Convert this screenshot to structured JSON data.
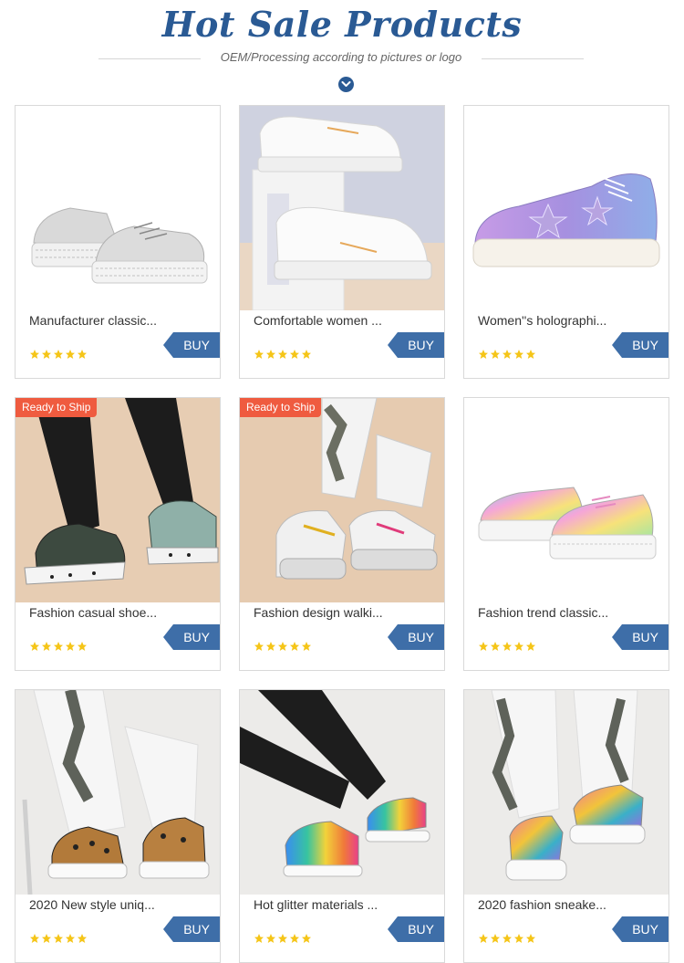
{
  "header": {
    "title": "Hot Sale Products",
    "subtitle": "OEM/Processing according to pictures or logo"
  },
  "colors": {
    "accent": "#2a5a94",
    "buy": "#3e6ea8",
    "badge": "#ef5b3f",
    "star": "#f5c518"
  },
  "products": [
    {
      "name": "Manufacturer classic...",
      "buy_label": "BUY",
      "badge": "",
      "rating": 5
    },
    {
      "name": "Comfortable women ...",
      "buy_label": "BUY",
      "badge": "",
      "rating": 5
    },
    {
      "name": "Women''s holographi...",
      "buy_label": "BUY",
      "badge": "",
      "rating": 5
    },
    {
      "name": "Fashion casual shoe...",
      "buy_label": "BUY",
      "badge": "Ready to Ship",
      "rating": 5
    },
    {
      "name": "Fashion design walki...",
      "buy_label": "BUY",
      "badge": "Ready to Ship",
      "rating": 5
    },
    {
      "name": "Fashion trend classic...",
      "buy_label": "BUY",
      "badge": "",
      "rating": 5
    },
    {
      "name": "2020 New style uniq...",
      "buy_label": "BUY",
      "badge": "",
      "rating": 5
    },
    {
      "name": "Hot glitter materials ...",
      "buy_label": "BUY",
      "badge": "",
      "rating": 5
    },
    {
      "name": "2020 fashion sneake...",
      "buy_label": "BUY",
      "badge": "",
      "rating": 5
    }
  ]
}
